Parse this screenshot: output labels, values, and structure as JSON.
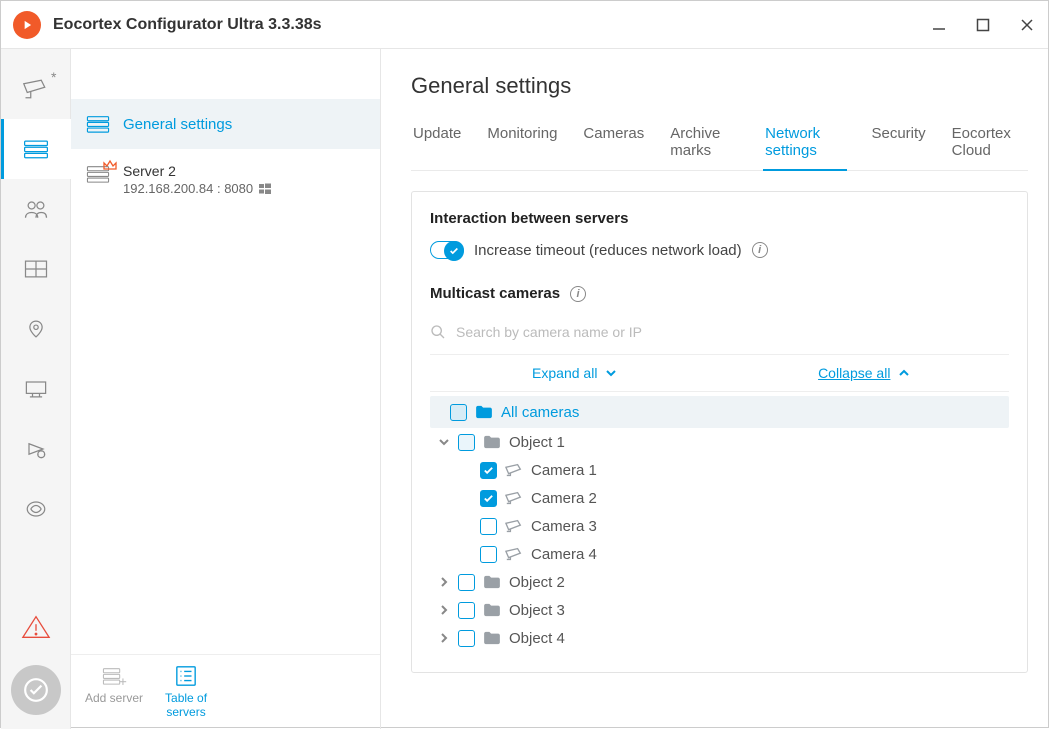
{
  "window": {
    "title": "Eocortex Configurator Ultra 3.3.38s"
  },
  "rail": {
    "cameras_badge": "*"
  },
  "serverPanel": {
    "general": "General settings",
    "server": {
      "name": "Server 2",
      "addr": "192.168.200.84 : 8080"
    },
    "addServer": "Add server",
    "tableOfServers": "Table of\nservers"
  },
  "main": {
    "heading": "General settings",
    "tabs": [
      "Update",
      "Monitoring",
      "Cameras",
      "Archive marks",
      "Network settings",
      "Security",
      "Eocortex Cloud"
    ],
    "activeTab": 4,
    "section1": {
      "title": "Interaction between servers",
      "toggleLabel": "Increase timeout (reduces network load)"
    },
    "section2": {
      "title": "Multicast cameras",
      "searchPlaceholder": "Search by camera name or IP",
      "expand": "Expand all",
      "collapse": "Collapse all",
      "tree": {
        "root": "All cameras",
        "object1": {
          "label": "Object 1",
          "expanded": true,
          "cameras": [
            {
              "label": "Camera 1",
              "checked": true
            },
            {
              "label": "Camera 2",
              "checked": true
            },
            {
              "label": "Camera 3",
              "checked": false
            },
            {
              "label": "Camera 4",
              "checked": false
            }
          ]
        },
        "others": [
          {
            "label": "Object 2"
          },
          {
            "label": "Object 3"
          },
          {
            "label": "Object 4"
          }
        ]
      }
    }
  }
}
